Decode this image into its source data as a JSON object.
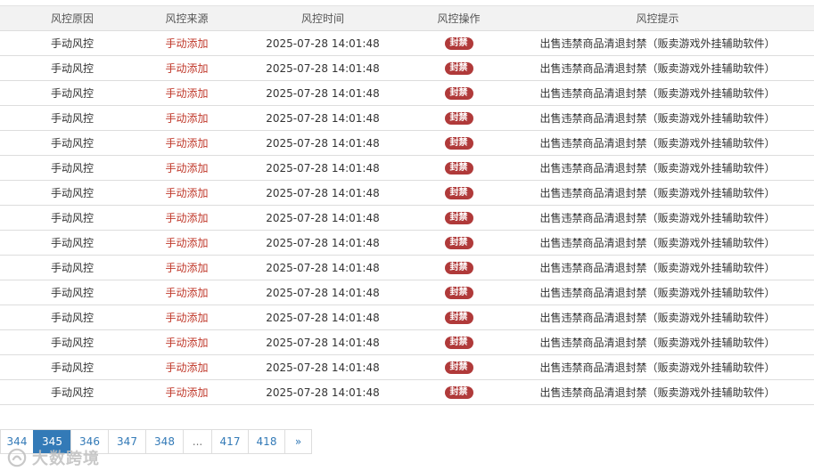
{
  "table": {
    "headers": [
      "风控原因",
      "风控来源",
      "风控时间",
      "风控操作",
      "风控提示"
    ],
    "rows": [
      {
        "reason": "手动风控",
        "source": "手动添加",
        "time": "2025-07-28 14:01:48",
        "action": "封禁",
        "tip": "出售违禁商品清退封禁（贩卖游戏外挂辅助软件）"
      },
      {
        "reason": "手动风控",
        "source": "手动添加",
        "time": "2025-07-28 14:01:48",
        "action": "封禁",
        "tip": "出售违禁商品清退封禁（贩卖游戏外挂辅助软件）"
      },
      {
        "reason": "手动风控",
        "source": "手动添加",
        "time": "2025-07-28 14:01:48",
        "action": "封禁",
        "tip": "出售违禁商品清退封禁（贩卖游戏外挂辅助软件）"
      },
      {
        "reason": "手动风控",
        "source": "手动添加",
        "time": "2025-07-28 14:01:48",
        "action": "封禁",
        "tip": "出售违禁商品清退封禁（贩卖游戏外挂辅助软件）"
      },
      {
        "reason": "手动风控",
        "source": "手动添加",
        "time": "2025-07-28 14:01:48",
        "action": "封禁",
        "tip": "出售违禁商品清退封禁（贩卖游戏外挂辅助软件）"
      },
      {
        "reason": "手动风控",
        "source": "手动添加",
        "time": "2025-07-28 14:01:48",
        "action": "封禁",
        "tip": "出售违禁商品清退封禁（贩卖游戏外挂辅助软件）"
      },
      {
        "reason": "手动风控",
        "source": "手动添加",
        "time": "2025-07-28 14:01:48",
        "action": "封禁",
        "tip": "出售违禁商品清退封禁（贩卖游戏外挂辅助软件）"
      },
      {
        "reason": "手动风控",
        "source": "手动添加",
        "time": "2025-07-28 14:01:48",
        "action": "封禁",
        "tip": "出售违禁商品清退封禁（贩卖游戏外挂辅助软件）"
      },
      {
        "reason": "手动风控",
        "source": "手动添加",
        "time": "2025-07-28 14:01:48",
        "action": "封禁",
        "tip": "出售违禁商品清退封禁（贩卖游戏外挂辅助软件）"
      },
      {
        "reason": "手动风控",
        "source": "手动添加",
        "time": "2025-07-28 14:01:48",
        "action": "封禁",
        "tip": "出售违禁商品清退封禁（贩卖游戏外挂辅助软件）"
      },
      {
        "reason": "手动风控",
        "source": "手动添加",
        "time": "2025-07-28 14:01:48",
        "action": "封禁",
        "tip": "出售违禁商品清退封禁（贩卖游戏外挂辅助软件）"
      },
      {
        "reason": "手动风控",
        "source": "手动添加",
        "time": "2025-07-28 14:01:48",
        "action": "封禁",
        "tip": "出售违禁商品清退封禁（贩卖游戏外挂辅助软件）"
      },
      {
        "reason": "手动风控",
        "source": "手动添加",
        "time": "2025-07-28 14:01:48",
        "action": "封禁",
        "tip": "出售违禁商品清退封禁（贩卖游戏外挂辅助软件）"
      },
      {
        "reason": "手动风控",
        "source": "手动添加",
        "time": "2025-07-28 14:01:48",
        "action": "封禁",
        "tip": "出售违禁商品清退封禁（贩卖游戏外挂辅助软件）"
      },
      {
        "reason": "手动风控",
        "source": "手动添加",
        "time": "2025-07-28 14:01:48",
        "action": "封禁",
        "tip": "出售违禁商品清退封禁（贩卖游戏外挂辅助软件）"
      }
    ]
  },
  "pagination": {
    "pages": [
      "344",
      "345",
      "346",
      "347",
      "348",
      "...",
      "417",
      "418",
      "»"
    ],
    "active": "345"
  },
  "watermark": {
    "text": "大数跨境",
    "icon": "logo-icon"
  },
  "colors": {
    "accent": "#337ab7",
    "danger_text": "#c0392b",
    "badge": "#b03a3a",
    "header_bg": "#f2f2f2"
  }
}
